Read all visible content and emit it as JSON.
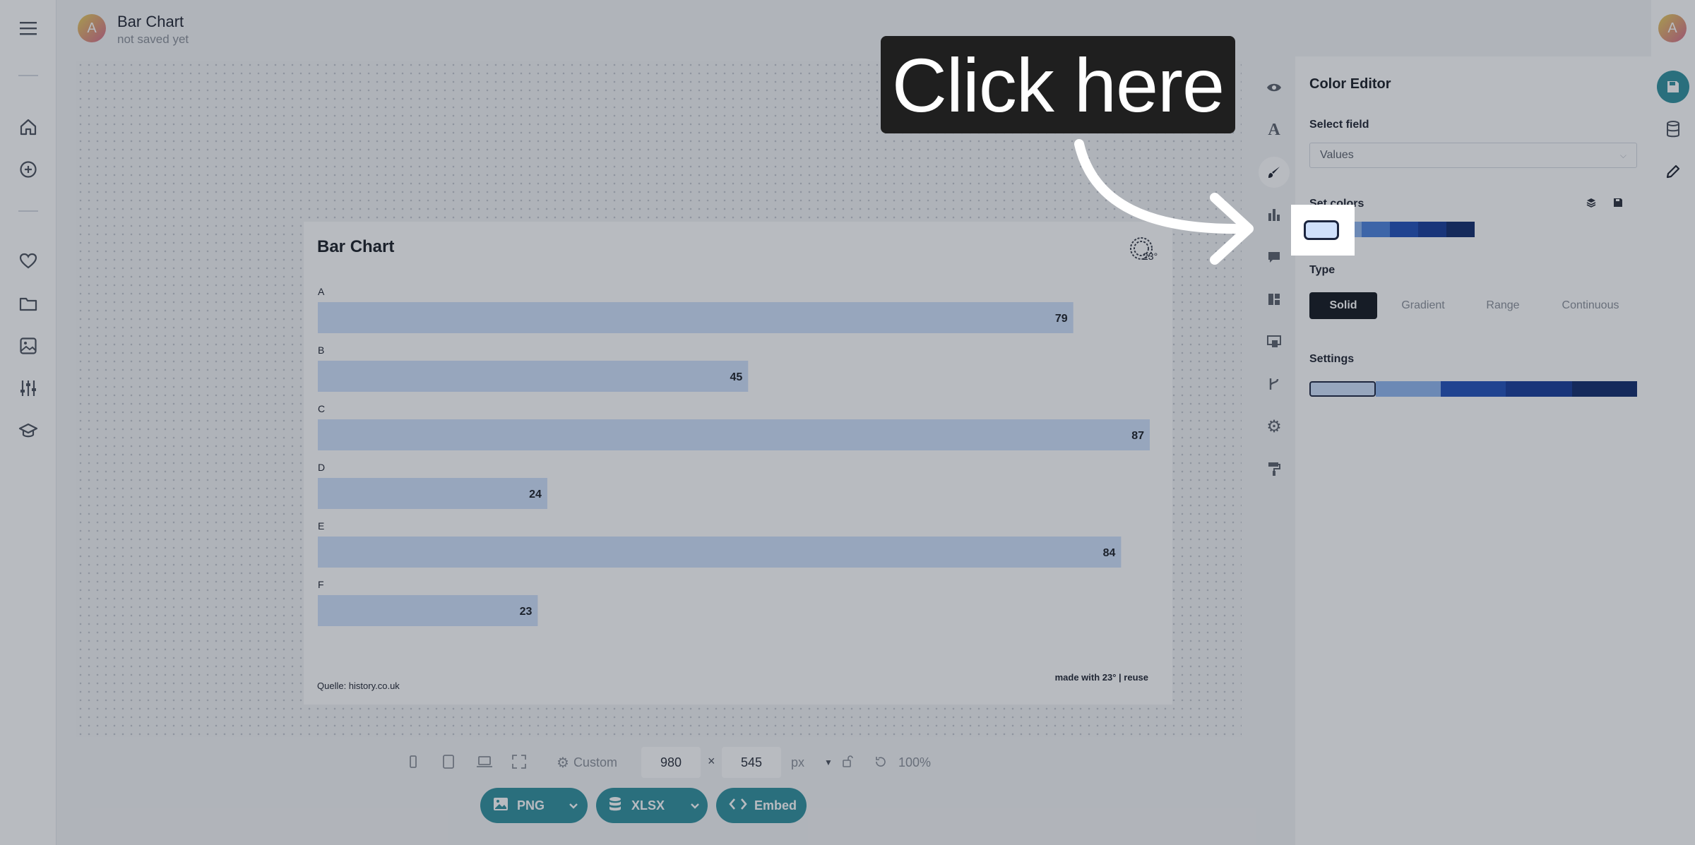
{
  "app": {
    "avatar_initial": "A",
    "document_title": "Bar Chart",
    "save_status": "not saved yet"
  },
  "left_nav": {
    "icons": [
      "menu-icon",
      "home-icon",
      "add-icon",
      "favorites-icon",
      "folder-icon",
      "image-icon",
      "settings-sliders-icon",
      "learn-icon"
    ]
  },
  "chart": {
    "title": "Bar Chart",
    "source": "Quelle: history.co.uk",
    "credit": "made with 23° | reuse",
    "bar_color": "#cfe0fb"
  },
  "chart_data": {
    "type": "bar",
    "orientation": "horizontal",
    "title": "Bar Chart",
    "categories": [
      "A",
      "B",
      "C",
      "D",
      "E",
      "F"
    ],
    "values": [
      79,
      45,
      87,
      24,
      84,
      23
    ],
    "xlim": [
      0,
      87
    ],
    "grid": false,
    "data_labels": true
  },
  "bottom_bar": {
    "preset_label": "Custom",
    "width_value": "980",
    "height_value": "545",
    "times_sign": "×",
    "unit": "px",
    "zoom": "100%"
  },
  "export": {
    "png_label": "PNG",
    "xlsx_label": "XLSX",
    "embed_label": "Embed"
  },
  "panel": {
    "title": "Color Editor",
    "select_field_label": "Select field",
    "select_field_value": "Values",
    "set_colors_label": "Set colors",
    "type_label": "Type",
    "type_options": [
      "Solid",
      "Gradient",
      "Range",
      "Continuous"
    ],
    "type_selected": "Solid",
    "settings_label": "Settings",
    "palette": [
      "#cfe0fb",
      "#8fb5ef",
      "#4a80dc",
      "#1f4fb8",
      "#163a99",
      "#102a6b"
    ]
  },
  "overlay": {
    "callout_text": "Click here"
  }
}
